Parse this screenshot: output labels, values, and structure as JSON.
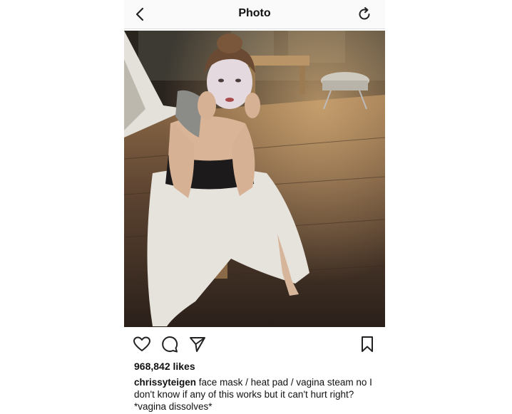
{
  "header": {
    "title": "Photo",
    "back_icon": "chevron-left-icon",
    "refresh_icon": "refresh-icon"
  },
  "photo": {
    "description_icon": "photo"
  },
  "actions": {
    "like_icon": "heart-icon",
    "comment_icon": "comment-icon",
    "share_icon": "send-icon",
    "save_icon": "bookmark-icon"
  },
  "likes": "968,842 likes",
  "caption": {
    "username": "chrissyteigen",
    "text": " face mask / heat pad / vagina steam no I don't know if any of this works but it can't hurt right? *vagina dissolves*"
  }
}
